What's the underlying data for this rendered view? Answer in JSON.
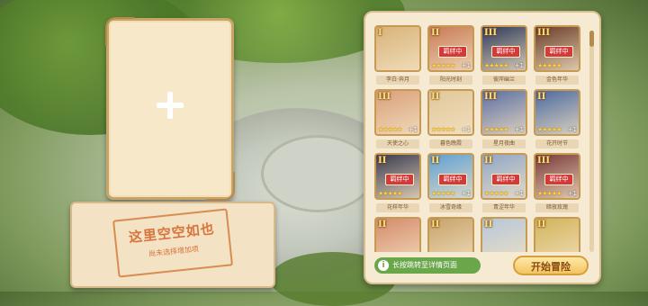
{
  "left_card": {
    "empty_icon": "plus-icon"
  },
  "info_panel": {
    "title": "这里空空如也",
    "subtitle": "尚未选择增加项"
  },
  "roster": {
    "heroes": [
      {
        "rank": "I",
        "status": "",
        "stars": "",
        "plus": "",
        "name": "李白·奔月",
        "color": "#d8b37a"
      },
      {
        "rank": "II",
        "status": "羁绊中",
        "stars": "★★★★★",
        "plus": "+1",
        "name": "阳光时刻",
        "color": "#c97b55"
      },
      {
        "rank": "III",
        "status": "羁绊中",
        "stars": "★★★★★",
        "plus": "+1",
        "name": "彼岸幽兰",
        "color": "#2f3a5a"
      },
      {
        "rank": "III",
        "status": "羁绊中",
        "stars": "★★★★★",
        "plus": "",
        "name": "金色年华",
        "color": "#6b3d2a"
      },
      {
        "rank": "III",
        "status": "",
        "stars": "★★★★★",
        "plus": "+1",
        "name": "天使之心",
        "color": "#d9a07a"
      },
      {
        "rank": "II",
        "status": "",
        "stars": "★★★★★",
        "plus": "+1",
        "name": "暮色晚霞",
        "color": "#e1c79a"
      },
      {
        "rank": "III",
        "status": "",
        "stars": "★★★★★",
        "plus": "+1",
        "name": "星月夜曲",
        "color": "#5c6fa3"
      },
      {
        "rank": "II",
        "status": "",
        "stars": "★★★★★",
        "plus": "+1",
        "name": "花开时节",
        "color": "#4c6aa0"
      },
      {
        "rank": "II",
        "status": "羁绊中",
        "stars": "★★★★★",
        "plus": "",
        "name": "花样年华",
        "color": "#3b3b4f"
      },
      {
        "rank": "II",
        "status": "羁绊中",
        "stars": "★★★★★",
        "plus": "+1",
        "name": "冰雪奇缘",
        "color": "#5ea0d4"
      },
      {
        "rank": "II",
        "status": "羁绊中",
        "stars": "★★★★★",
        "plus": "+1",
        "name": "青涩年华",
        "color": "#8fa7c7"
      },
      {
        "rank": "III",
        "status": "羁绊中",
        "stars": "★★★★★",
        "plus": "+1",
        "name": "暗夜玫瑰",
        "color": "#7a3a3a"
      },
      {
        "rank": "II",
        "status": "",
        "stars": "",
        "plus": "",
        "name": "",
        "color": "#d58b6a"
      },
      {
        "rank": "II",
        "status": "",
        "stars": "",
        "plus": "",
        "name": "",
        "color": "#c8a36a"
      },
      {
        "rank": "II",
        "status": "",
        "stars": "",
        "plus": "",
        "name": "",
        "color": "#b6c7d8"
      },
      {
        "rank": "II",
        "status": "",
        "stars": "",
        "plus": "",
        "name": "",
        "color": "#d2b35a"
      }
    ],
    "scroll_fraction": 0.0
  },
  "hint_button": {
    "icon": "info-icon",
    "label": "长按跳转至详情页面"
  },
  "start_button": {
    "label": "开始冒险"
  }
}
